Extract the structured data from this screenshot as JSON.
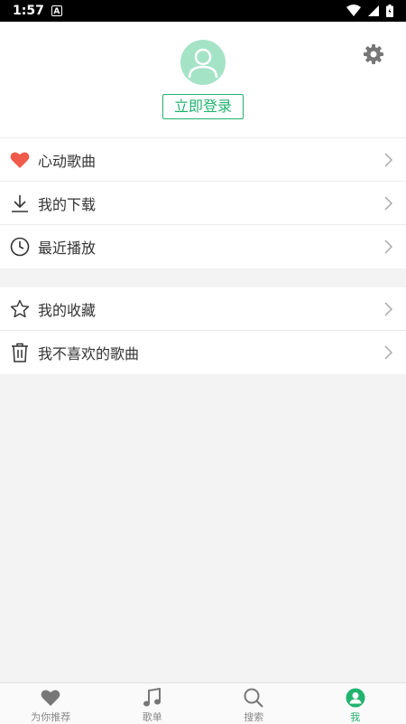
{
  "status_bar": {
    "time": "1:57",
    "badge": "A"
  },
  "header": {
    "login_label": "立即登录"
  },
  "menu_group_1": [
    {
      "label": "心动歌曲",
      "icon": "heart-icon"
    },
    {
      "label": "我的下载",
      "icon": "download-icon"
    },
    {
      "label": "最近播放",
      "icon": "clock-icon"
    }
  ],
  "menu_group_2": [
    {
      "label": "我的收藏",
      "icon": "star-icon"
    },
    {
      "label": "我不喜欢的歌曲",
      "icon": "trash-icon"
    }
  ],
  "tabbar": {
    "items": [
      {
        "label": "为你推荐",
        "icon": "heart-icon"
      },
      {
        "label": "歌单",
        "icon": "music-note-icon"
      },
      {
        "label": "搜索",
        "icon": "search-icon"
      },
      {
        "label": "我",
        "icon": "person-icon"
      }
    ],
    "active_index": 3
  },
  "colors": {
    "accent": "#21b36f",
    "heart": "#f05a4a",
    "avatar_bg": "#a5e3c7"
  }
}
